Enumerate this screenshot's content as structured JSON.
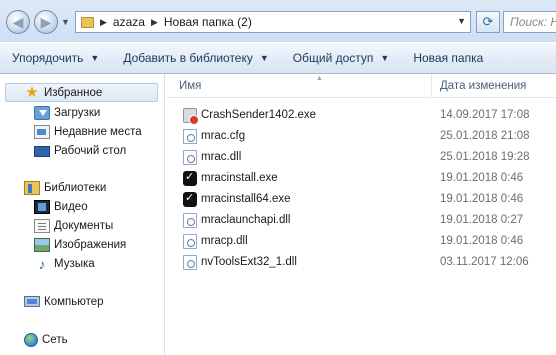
{
  "address_bar": {
    "crumbs": [
      "azaza",
      "Новая папка (2)"
    ],
    "search_placeholder": "Поиск: Новая"
  },
  "toolbar": {
    "organize": "Упорядочить",
    "add_library": "Добавить в библиотеку",
    "share": "Общий доступ",
    "new_folder": "Новая папка"
  },
  "nav": {
    "favorites": "Избранное",
    "downloads": "Загрузки",
    "recent": "Недавние места",
    "desktop": "Рабочий стол",
    "libraries": "Библиотеки",
    "video": "Видео",
    "documents": "Документы",
    "images": "Изображения",
    "music": "Музыка",
    "computer": "Компьютер",
    "network": "Сеть"
  },
  "columns": {
    "name": "Имя",
    "date": "Дата изменения"
  },
  "files": [
    {
      "name": "CrashSender1402.exe",
      "date": "14.09.2017 17:08",
      "icon": "crash-sender-icon"
    },
    {
      "name": "mrac.cfg",
      "date": "25.01.2018 21:08",
      "icon": "config-file-icon"
    },
    {
      "name": "mrac.dll",
      "date": "25.01.2018 19:28",
      "icon": "dll-file-icon"
    },
    {
      "name": "mracinstall.exe",
      "date": "19.01.2018 0:46",
      "icon": "shield-exe-icon"
    },
    {
      "name": "mracinstall64.exe",
      "date": "19.01.2018 0:46",
      "icon": "shield-exe-icon"
    },
    {
      "name": "mraclaunchapi.dll",
      "date": "19.01.2018 0:27",
      "icon": "dll-file-icon"
    },
    {
      "name": "mracp.dll",
      "date": "19.01.2018 0:46",
      "icon": "dll-file-icon"
    },
    {
      "name": "nvToolsExt32_1.dll",
      "date": "03.11.2017 12:06",
      "icon": "dll-file-icon"
    }
  ]
}
